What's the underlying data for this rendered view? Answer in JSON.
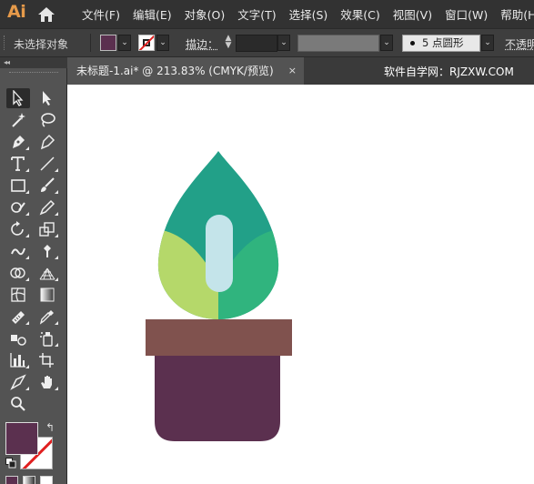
{
  "app": {
    "logo": "Ai"
  },
  "menu": [
    "文件(F)",
    "编辑(E)",
    "对象(O)",
    "文字(T)",
    "选择(S)",
    "效果(C)",
    "视图(V)",
    "窗口(W)",
    "帮助(H)"
  ],
  "control_bar": {
    "selection_status": "未选择对象",
    "stroke_label": "描边：",
    "brush_dot_size": "5",
    "brush_label": "点圆形",
    "opacity_label": "不透明",
    "fill_color": "#5b304f"
  },
  "document": {
    "tab_title": "未标题-1.ai* @ 213.83% (CMYK/预览)",
    "close_symbol": "×",
    "site_watermark": "软件自学网：RJZXW.COM"
  },
  "tools_panel": {
    "collapse_symbol": "◂◂",
    "swap_symbol": "↰",
    "tools": [
      "selection-tool",
      "direct-selection-tool",
      "magic-wand-tool",
      "lasso-tool",
      "pen-tool",
      "curvature-tool",
      "type-tool",
      "line-tool",
      "rectangle-tool",
      "paintbrush-tool",
      "shaper-tool",
      "pencil-tool",
      "rotate-tool",
      "scale-tool",
      "warp-tool",
      "puppet-warp-tool",
      "shape-builder-tool",
      "perspective-grid-tool",
      "mesh-tool",
      "gradient-tool",
      "measure-tool",
      "eyedropper-tool",
      "blend-tool",
      "symbol-sprayer-tool",
      "column-graph-tool",
      "artboard-tool",
      "slice-tool",
      "hand-tool",
      "zoom-tool"
    ]
  },
  "colors": {
    "leaf_top": "#22a088",
    "leaf_left": "#b5d86a",
    "leaf_right": "#30b47e",
    "leaf_vein": "#c4e4ea",
    "pot_rim": "#80524e",
    "pot_body": "#5b304f"
  }
}
